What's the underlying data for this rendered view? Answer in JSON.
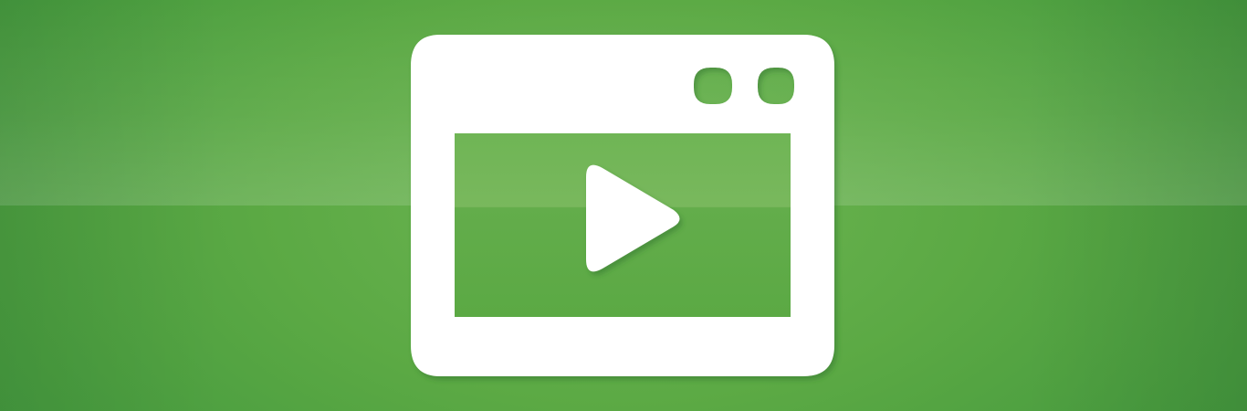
{
  "banner": {
    "background_top": "#6db552",
    "background_bottom": "#3f953d"
  },
  "icon": {
    "name": "video-player-icon",
    "frame_color": "#ffffff",
    "screen_color": "#5ba944",
    "play_color": "#ffffff",
    "shadow_color": "#2e6e2a"
  }
}
